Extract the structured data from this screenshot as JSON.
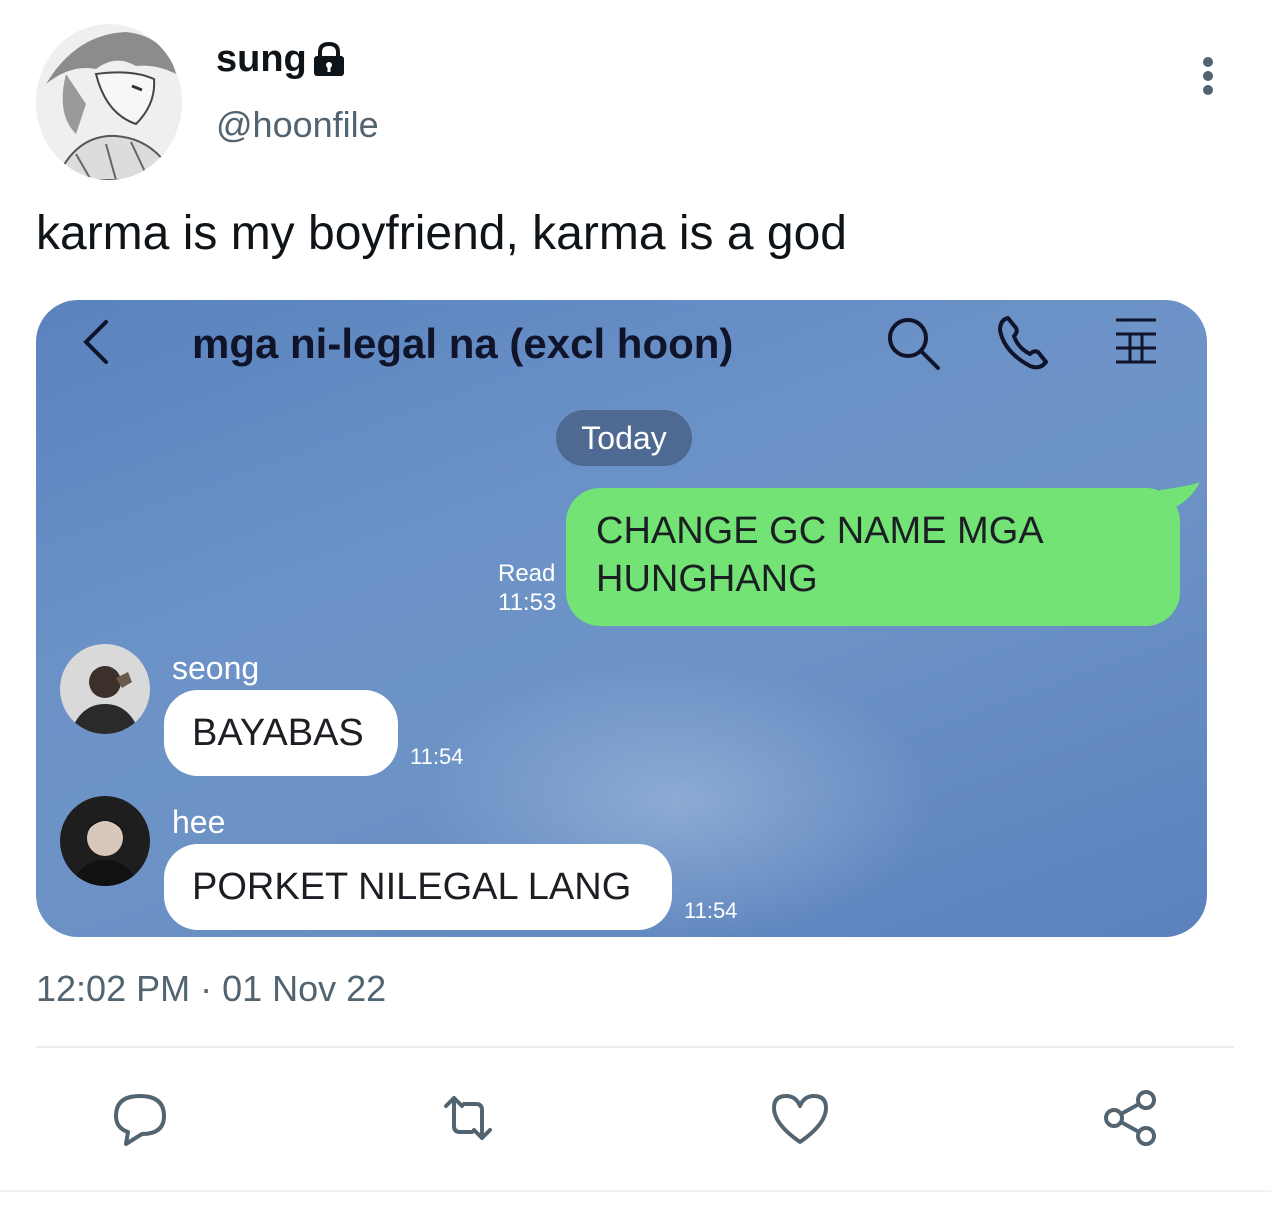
{
  "author": {
    "name": "sung",
    "handle": "@hoonfile",
    "locked_icon": "lock-icon",
    "avatar_icon": "manga-avatar"
  },
  "tweet": {
    "text": "karma is my boyfriend, karma is a god",
    "timestamp": "12:02 PM · 01 Nov 22"
  },
  "chat": {
    "title": "mga ni-legal na (excl hoon)",
    "header_icons": [
      "chevron-left-icon",
      "search-icon",
      "phone-icon",
      "menu-icon"
    ],
    "date_pill": "Today",
    "messages": [
      {
        "sender": "",
        "text": "CHANGE GC NAME MGA HUNGHANG",
        "status": "Read",
        "time": "11:53",
        "outgoing": true
      },
      {
        "sender": "seong",
        "text": "BAYABAS",
        "time": "11:54",
        "outgoing": false
      },
      {
        "sender": "hee",
        "text": "PORKET NILEGAL LANG",
        "time": "11:54",
        "outgoing": false
      }
    ],
    "colors": {
      "background": "#6289c2",
      "outgoing_bubble": "#72e374",
      "incoming_bubble": "#ffffff",
      "date_pill": "#4e6a92"
    }
  },
  "actions": [
    "reply-icon",
    "retweet-icon",
    "like-icon",
    "share-icon"
  ],
  "colors": {
    "secondary_text": "#536471",
    "primary_text": "#0f1419"
  }
}
